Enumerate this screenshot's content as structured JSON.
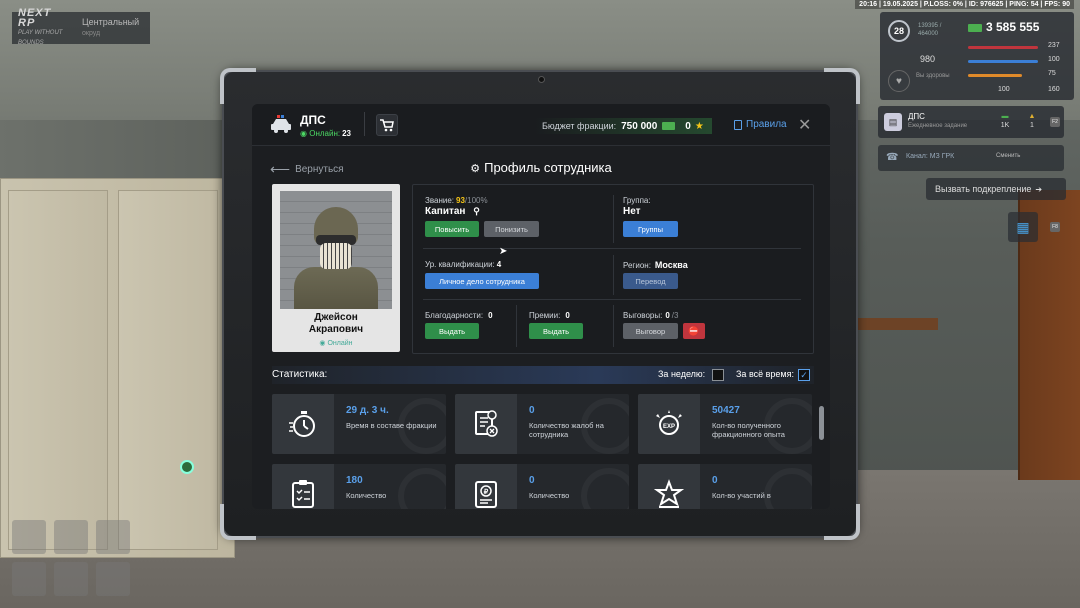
{
  "hud": {
    "topbar": "20:16 | 19.05.2025 | P.LOSS: 0% | ID: 976625 | PING: 54 | FPS: 90",
    "logo": "NEXT RP",
    "logo_sub": "PLAY WITHOUT BOUNDS",
    "server_name": "Центральный",
    "server_sub": "окруд",
    "level": "28",
    "xp": "139395 / 464000",
    "money": "3 585 555",
    "stat_980": "980",
    "stats": [
      "237",
      "100",
      "75",
      "100",
      "160"
    ],
    "heart_label": "Вы здоровы",
    "job_title": "ДПС",
    "job_sub": "Ежедневное задание",
    "job_reward_1": "1K",
    "job_reward_2": "1",
    "key_f2": "F2",
    "radio_channel": "Канал: МЗ ГРК",
    "radio_change": "Сменить",
    "backup": "Вызвать подкрепление",
    "key_f8": "F8"
  },
  "header": {
    "faction": "ДПС",
    "online_label": "Онлайн:",
    "online_count": "23",
    "budget_label": "Бюджет фракции:",
    "budget_value": "750 000",
    "stars_value": "0",
    "rules": "Правила"
  },
  "nav": {
    "back": "Вернуться",
    "title": "Профиль сотрудника"
  },
  "employee": {
    "first_name": "Джейсон",
    "last_name": "Акрапович",
    "status": "Онлайн"
  },
  "info": {
    "rank_label": "Звание:",
    "rank_progress": "93",
    "rank_max": "/100%",
    "rank_name": "Капитан",
    "promote": "Повысить",
    "demote": "Понизить",
    "group_label": "Группа:",
    "group_value": "Нет",
    "groups_btn": "Группы",
    "qual_label": "Ур. квалификации:",
    "qual_value": "4",
    "personal_file_btn": "Личное дело сотрудника",
    "region_label": "Регион:",
    "region_value": "Москва",
    "transfer_btn": "Перевод",
    "thanks_label": "Благодарности:",
    "thanks_value": "0",
    "thanks_btn": "Выдать",
    "bonus_label": "Премии:",
    "bonus_value": "0",
    "bonus_btn": "Выдать",
    "reprimand_label": "Выговоры:",
    "reprimand_value": "0",
    "reprimand_max": "/3",
    "reprimand_btn": "Выговор"
  },
  "stats": {
    "title": "Статистика:",
    "week_label": "За неделю:",
    "all_time_label": "За всё время:",
    "tiles": [
      {
        "value": "29 д. 3 ч.",
        "label": "Время в составе фракции",
        "icon": "stopwatch-icon"
      },
      {
        "value": "0",
        "label": "Количество жалоб на сотрудника",
        "icon": "complaint-document-icon"
      },
      {
        "value": "50427",
        "label": "Кол-во полученного фракционного опыта",
        "icon": "exp-badge-icon"
      },
      {
        "value": "180",
        "label": "Количество",
        "icon": "checklist-icon"
      },
      {
        "value": "0",
        "label": "Количество",
        "icon": "money-document-icon"
      },
      {
        "value": "0",
        "label": "Кол-во участий в",
        "icon": "star-trophy-icon"
      }
    ]
  },
  "colors": {
    "accent_blue": "#3b7fd6",
    "accent_green": "#2f8f4a",
    "online_green": "#4cd964",
    "rank_yellow": "#f5c518"
  }
}
